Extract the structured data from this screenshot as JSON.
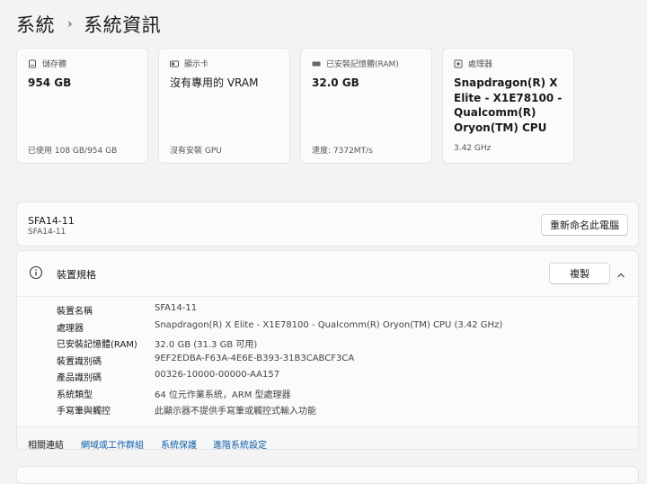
{
  "breadcrumb": {
    "parent": "系統",
    "separator": "›",
    "current": "系統資訊"
  },
  "cards": [
    {
      "label": "儲存體",
      "icon": "storage-icon",
      "value": "954 GB",
      "footer": "已使用 108 GB/954 GB"
    },
    {
      "label": "顯示卡",
      "icon": "display-icon",
      "value": "沒有專用的 VRAM",
      "footer": "沒有安裝 GPU"
    },
    {
      "label": "已安裝記憶體(RAM)",
      "icon": "memory-icon",
      "value": "32.0 GB",
      "footer": "速度: 7372MT/s"
    },
    {
      "label": "處理器",
      "icon": "processor-icon",
      "value": "Snapdragon(R) X Elite - X1E78100 - Qualcomm(R) Oryon(TM) CPU",
      "footer": "3.42 GHz"
    }
  ],
  "device": {
    "name": "SFA14-11",
    "subtitle": "SFA14-11",
    "rename_label": "重新命名此電腦"
  },
  "specs": {
    "title": "裝置規格",
    "copy_label": "複製",
    "rows": [
      {
        "key": "裝置名稱",
        "value": "SFA14-11"
      },
      {
        "key": "處理器",
        "value": "Snapdragon(R) X Elite - X1E78100 - Qualcomm(R) Oryon(TM) CPU (3.42 GHz)"
      },
      {
        "key": "已安裝記憶體(RAM)",
        "value": "32.0 GB (31.3 GB 可用)"
      },
      {
        "key": "裝置識別碼",
        "value": "9EF2EDBA-F63A-4E6E-B393-31B3CABCF3CA"
      },
      {
        "key": "產品識別碼",
        "value": "00326-10000-00000-AA157"
      },
      {
        "key": "系統類型",
        "value": "64 位元作業系統，ARM 型處理器"
      },
      {
        "key": "手寫筆與觸控",
        "value": "此顯示器不提供手寫筆或觸控式輸入功能"
      }
    ]
  },
  "related": {
    "label": "相關連結",
    "links": [
      "網域或工作群組",
      "系統保護",
      "進階系統設定"
    ]
  },
  "colors": {
    "accent_link": "#0f5ea8",
    "background": "#f3f3f3",
    "card": "#fbfbfb"
  }
}
